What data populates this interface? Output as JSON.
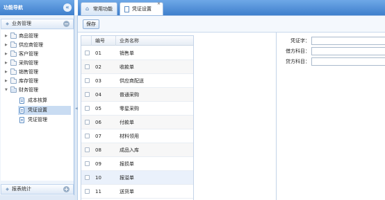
{
  "nav": {
    "title": "功能导航",
    "collapse_icon": "double-chevron-left-icon",
    "business_panel": {
      "title": "业务管理",
      "toggle": "−"
    },
    "tree": [
      {
        "label": "商品管理",
        "expanded": false
      },
      {
        "label": "供应商管理",
        "expanded": false
      },
      {
        "label": "客户管理",
        "expanded": false
      },
      {
        "label": "采购管理",
        "expanded": false
      },
      {
        "label": "销售管理",
        "expanded": false
      },
      {
        "label": "库存管理",
        "expanded": false
      },
      {
        "label": "财务管理",
        "expanded": true,
        "children": [
          {
            "label": "成本核算",
            "selected": false
          },
          {
            "label": "凭证设置",
            "selected": true
          },
          {
            "label": "凭证管理",
            "selected": false
          }
        ]
      }
    ],
    "report_panel": {
      "title": "报表统计",
      "toggle": "+"
    }
  },
  "tabs": [
    {
      "label": "常用功能",
      "icon": "home-icon",
      "active": false
    },
    {
      "label": "凭证设置",
      "icon": "document-icon",
      "active": true
    }
  ],
  "toolbar": {
    "save_label": "保存"
  },
  "grid": {
    "columns": [
      "编号",
      "业务名称"
    ],
    "rows": [
      {
        "code": "01",
        "name": "销售单"
      },
      {
        "code": "02",
        "name": "收款单"
      },
      {
        "code": "03",
        "name": "供应商配送"
      },
      {
        "code": "04",
        "name": "普通采购"
      },
      {
        "code": "05",
        "name": "零星采购"
      },
      {
        "code": "06",
        "name": "付款单"
      },
      {
        "code": "07",
        "name": "材料领用"
      },
      {
        "code": "08",
        "name": "成品入库"
      },
      {
        "code": "09",
        "name": "报损单"
      },
      {
        "code": "10",
        "name": "报溢单"
      },
      {
        "code": "11",
        "name": "送货单"
      }
    ],
    "selected_row": "10"
  },
  "form": {
    "voucher_word_label": "凭证字：",
    "debit_account_label": "借方科目：",
    "credit_account_label": "贷方科目：",
    "voucher_word_value": "",
    "debit_account_value": "",
    "credit_account_value": ""
  },
  "colors": {
    "header_blue": "#4f8fd8",
    "selection": "#c9dcf2",
    "nav_bg": "#eef4fb"
  }
}
